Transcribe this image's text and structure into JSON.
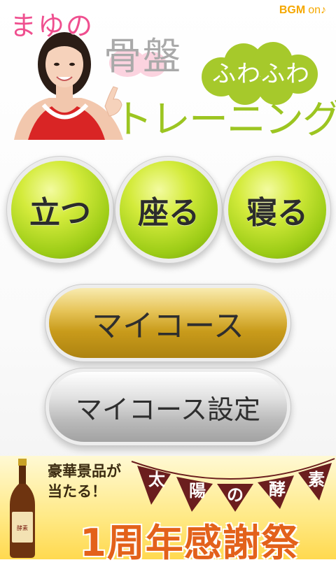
{
  "header": {
    "title_name": "まゆの",
    "title_bone": "骨盤",
    "title_fuwa": "ふわふわ",
    "title_training": "トレーニング",
    "bgm_label": "BGM",
    "bgm_state": "on♪"
  },
  "posture_buttons": [
    {
      "label": "立つ"
    },
    {
      "label": "座る"
    },
    {
      "label": "寝る"
    }
  ],
  "course_buttons": {
    "my_course": "マイコース",
    "my_course_settings": "マイコース設定"
  },
  "ad": {
    "prize_text": "豪華景品が\n当たる！",
    "flags": [
      "太",
      "陽",
      "の",
      "酵",
      "素"
    ],
    "headline": "1周年感謝祭",
    "bottle_label": "太陽の酵素"
  },
  "colors": {
    "green_button": "#9ccc16",
    "gold_button": "#c99b1b",
    "silver_button": "#bcbcbc",
    "title_pink": "#ef4f8f",
    "title_green": "#9cc521",
    "ad_headline": "#e3611a",
    "flag_maroon": "#6b1e1e"
  }
}
